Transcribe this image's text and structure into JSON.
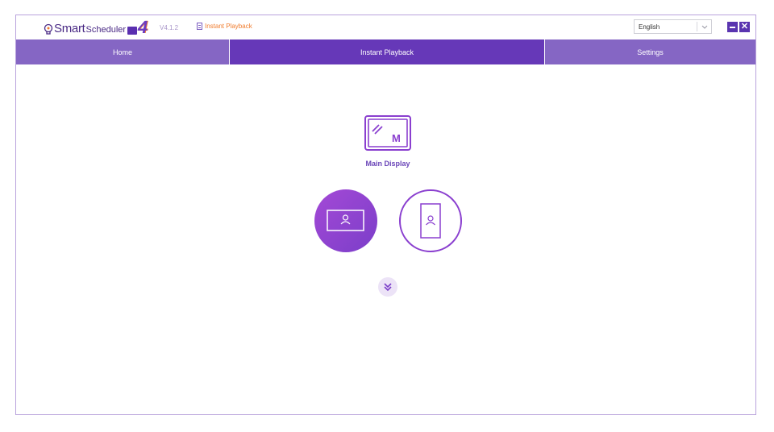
{
  "app": {
    "logo_smart": "Smart",
    "logo_scheduler": "Scheduler",
    "logo_version_mark": "4",
    "version": "V4.1.2",
    "breadcrumb": "Instant Playback"
  },
  "language": {
    "selected": "English"
  },
  "window_controls": {
    "minimize_icon": "minimize-icon",
    "close_icon": "close-icon",
    "close_glyph": "✕"
  },
  "nav": {
    "tabs": [
      {
        "label": "Home",
        "active": false
      },
      {
        "label": "Instant Playback",
        "active": true
      },
      {
        "label": "Settings",
        "active": false
      }
    ]
  },
  "main": {
    "display_badge": "M",
    "display_label": "Main Display",
    "orientations": [
      {
        "name": "landscape",
        "selected": true
      },
      {
        "name": "portrait",
        "selected": false
      }
    ]
  },
  "colors": {
    "accent": "#6638b8",
    "tab_inactive": "#8566c4",
    "breadcrumb": "#f07c2e",
    "orientation_gradient_start": "#a449d6",
    "orientation_gradient_end": "#7b3ec9"
  }
}
